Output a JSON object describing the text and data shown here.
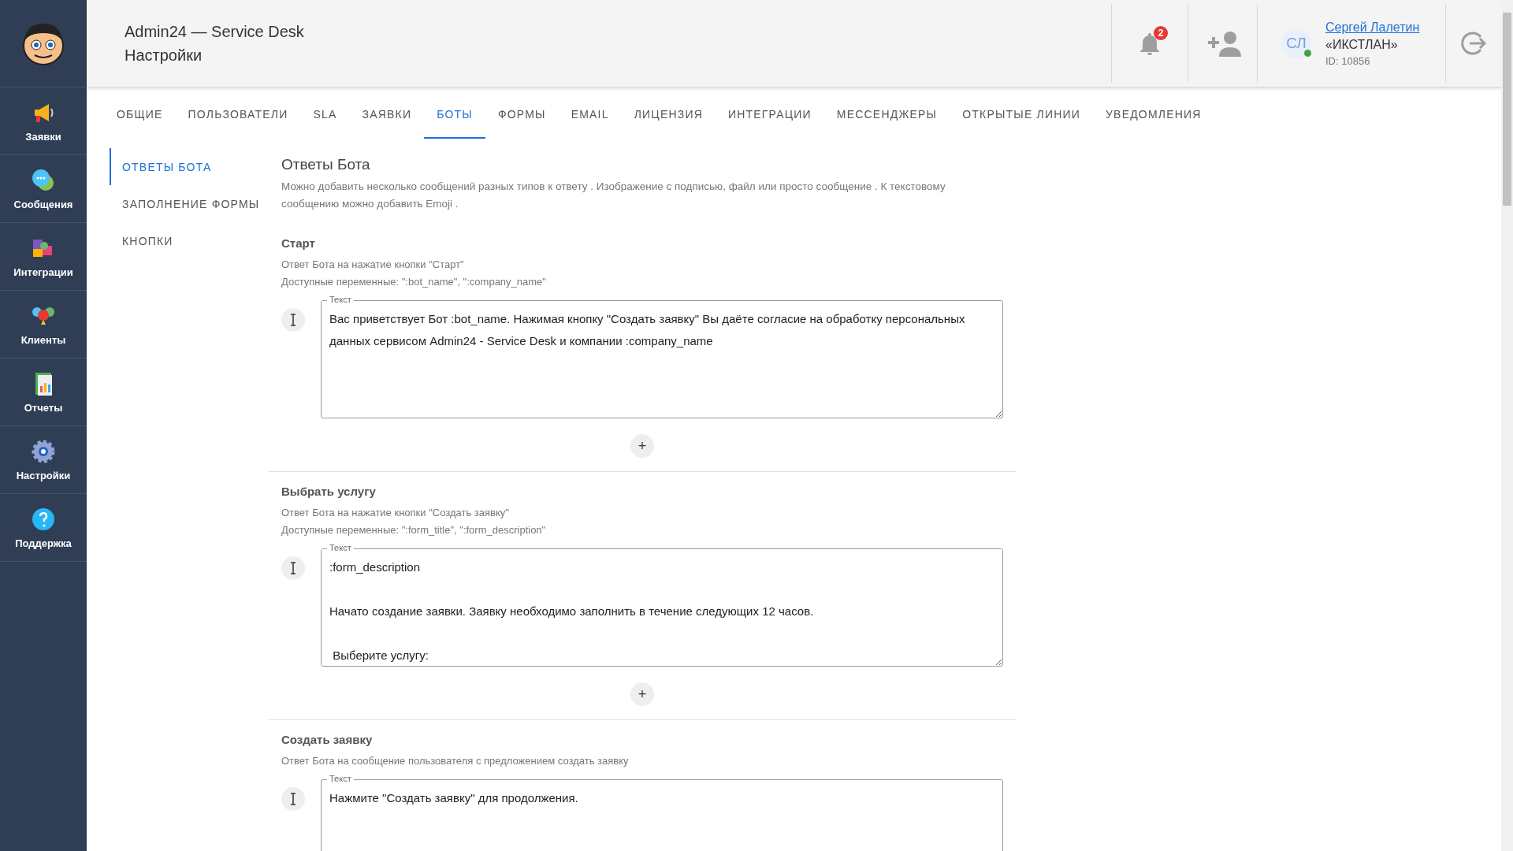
{
  "app": {
    "title": "Admin24 — Service Desk",
    "page": "Настройки"
  },
  "sidebar": {
    "items": [
      {
        "label": "Заявки",
        "kind": "megaphone"
      },
      {
        "label": "Сообщения",
        "kind": "chat"
      },
      {
        "label": "Интеграции",
        "kind": "puzzle"
      },
      {
        "label": "Клиенты",
        "kind": "people"
      },
      {
        "label": "Отчеты",
        "kind": "report"
      },
      {
        "label": "Настройки",
        "kind": "gear"
      },
      {
        "label": "Поддержка",
        "kind": "help"
      }
    ]
  },
  "header": {
    "notifications": {
      "count": "2"
    },
    "user": {
      "initials": "СЛ",
      "name": "Сергей Лалетин",
      "company": "«ИКСТЛАН»",
      "id": "ID: 10856",
      "online": true
    }
  },
  "tabs": [
    {
      "label": "ОБЩИЕ",
      "selected": false
    },
    {
      "label": "ПОЛЬЗОВАТЕЛИ",
      "selected": false
    },
    {
      "label": "SLA",
      "selected": false
    },
    {
      "label": "ЗАЯВКИ",
      "selected": false
    },
    {
      "label": "БОТЫ",
      "selected": true
    },
    {
      "label": "ФОРМЫ",
      "selected": false
    },
    {
      "label": "EMAIL",
      "selected": false
    },
    {
      "label": "ЛИЦЕНЗИЯ",
      "selected": false
    },
    {
      "label": "ИНТЕГРАЦИИ",
      "selected": false
    },
    {
      "label": "МЕССЕНДЖЕРЫ",
      "selected": false
    },
    {
      "label": "ОТКРЫТЫЕ ЛИНИИ",
      "selected": false
    },
    {
      "label": "УВЕДОМЛЕНИЯ",
      "selected": false
    }
  ],
  "subnav": [
    {
      "label": "ОТВЕТЫ БОТА",
      "selected": true
    },
    {
      "label": "ЗАПОЛНЕНИЕ ФОРМЫ",
      "selected": false
    },
    {
      "label": "КНОПКИ",
      "selected": false
    }
  ],
  "content": {
    "title": "Ответы Бота",
    "description": "Можно добавить несколько сообщений разных типов к ответу . Изображение с подписью, файл или просто сообщение . К текстовому сообщению можно добавить Emoji .",
    "sections": [
      {
        "title": "Старт",
        "hints": [
          "Ответ Бота на нажатие кнопки \"Старт\"",
          "Доступные переменные: \":bot_name\", \":company_name\""
        ],
        "field": {
          "label": "Текст",
          "value": "Вас приветствует Бот :bot_name. Нажимая кнопку \"Создать заявку\" Вы даёте согласие на обработку персональных данных сервисом Admin24 - Service Desk и компании :company_name"
        },
        "add": "+"
      },
      {
        "title": "Выбрать услугу",
        "hints": [
          "Ответ Бота на нажатие кнопки \"Создать заявку\"",
          "Доступные переменные: \":form_title\", \":form_description\""
        ],
        "field": {
          "label": "Текст",
          "value": ":form_description\n\nНачато создание заявки. Заявку необходимо заполнить в течение следующих 12 часов.\n\n Выберите услугу:"
        },
        "add": "+"
      },
      {
        "title": "Создать заявку",
        "hints": [
          "Ответ Бота на сообщение пользователя с предложением создать заявку"
        ],
        "field": {
          "label": "Текст",
          "value": "Нажмите \"Создать заявку\" для продолжения."
        }
      }
    ]
  }
}
